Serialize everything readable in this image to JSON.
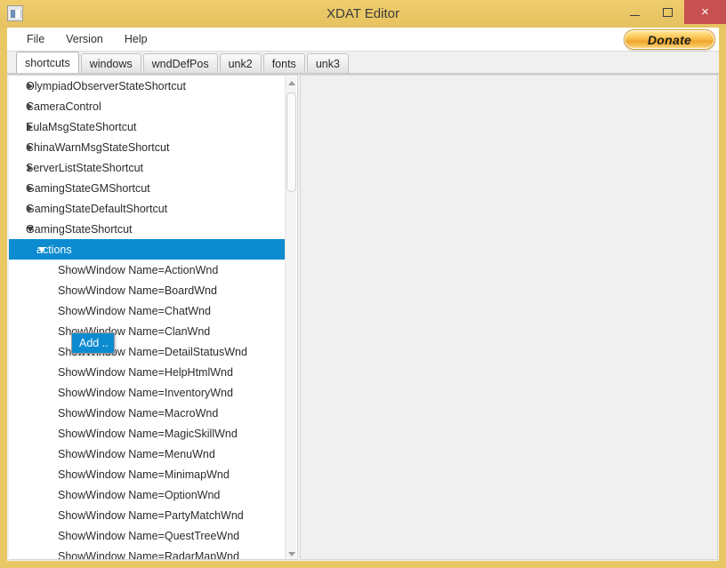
{
  "window": {
    "title": "XDAT Editor",
    "icon": "app-document-icon",
    "controls": {
      "minimize": "–",
      "maximize": "□",
      "close": "×"
    },
    "colors": {
      "frame": "#e9c765",
      "titlebar": "#eac765",
      "close_button": "#c75050",
      "selection": "#0d8bd0",
      "accent_donate": "#f6b63d"
    }
  },
  "menubar": {
    "items": [
      {
        "label": "File"
      },
      {
        "label": "Version"
      },
      {
        "label": "Help"
      }
    ],
    "donate_label": "Donate"
  },
  "tabs": {
    "active_index": 0,
    "items": [
      {
        "label": "shortcuts"
      },
      {
        "label": "windows"
      },
      {
        "label": "wndDefPos"
      },
      {
        "label": "unk2"
      },
      {
        "label": "fonts"
      },
      {
        "label": "unk3"
      }
    ]
  },
  "tree": {
    "rows": [
      {
        "label": "OlympiadObserverStateShortcut",
        "level": 0,
        "marker": "collapsed",
        "selected": false
      },
      {
        "label": "CameraControl",
        "level": 0,
        "marker": "collapsed",
        "selected": false
      },
      {
        "label": "EulaMsgStateShortcut",
        "level": 0,
        "marker": "collapsed",
        "selected": false
      },
      {
        "label": "ChinaWarnMsgStateShortcut",
        "level": 0,
        "marker": "collapsed",
        "selected": false
      },
      {
        "label": "ServerListStateShortcut",
        "level": 0,
        "marker": "collapsed",
        "selected": false
      },
      {
        "label": "GamingStateGMShortcut",
        "level": 0,
        "marker": "collapsed",
        "selected": false
      },
      {
        "label": "GamingStateDefaultShortcut",
        "level": 0,
        "marker": "collapsed",
        "selected": false
      },
      {
        "label": "GamingStateShortcut",
        "level": 0,
        "marker": "expanded",
        "selected": false
      },
      {
        "label": "actions",
        "level": 1,
        "marker": "expanded",
        "selected": true
      },
      {
        "label": "ShowWindow Name=ActionWnd",
        "level": 2,
        "marker": "none",
        "selected": false
      },
      {
        "label": "ShowWindow Name=BoardWnd",
        "level": 2,
        "marker": "none",
        "selected": false
      },
      {
        "label": "ShowWindow Name=ChatWnd",
        "level": 2,
        "marker": "none",
        "selected": false
      },
      {
        "label": "ShowWindow Name=ClanWnd",
        "level": 2,
        "marker": "none",
        "selected": false
      },
      {
        "label": "ShowWindow Name=DetailStatusWnd",
        "level": 2,
        "marker": "none",
        "selected": false
      },
      {
        "label": "ShowWindow Name=HelpHtmlWnd",
        "level": 2,
        "marker": "none",
        "selected": false
      },
      {
        "label": "ShowWindow Name=InventoryWnd",
        "level": 2,
        "marker": "none",
        "selected": false
      },
      {
        "label": "ShowWindow Name=MacroWnd",
        "level": 2,
        "marker": "none",
        "selected": false
      },
      {
        "label": "ShowWindow Name=MagicSkillWnd",
        "level": 2,
        "marker": "none",
        "selected": false
      },
      {
        "label": "ShowWindow Name=MenuWnd",
        "level": 2,
        "marker": "none",
        "selected": false
      },
      {
        "label": "ShowWindow Name=MinimapWnd",
        "level": 2,
        "marker": "none",
        "selected": false
      },
      {
        "label": "ShowWindow Name=OptionWnd",
        "level": 2,
        "marker": "none",
        "selected": false
      },
      {
        "label": "ShowWindow Name=PartyMatchWnd",
        "level": 2,
        "marker": "none",
        "selected": false
      },
      {
        "label": "ShowWindow Name=QuestTreeWnd",
        "level": 2,
        "marker": "none",
        "selected": false
      },
      {
        "label": "ShowWindow Name=RadarMapWnd",
        "level": 2,
        "marker": "none",
        "selected": false
      }
    ],
    "scrollbar": {
      "up_arrow": "▲",
      "down_arrow": "▼"
    }
  },
  "context_menu": {
    "items": [
      {
        "label": "Add ..",
        "highlighted": true
      }
    ]
  }
}
